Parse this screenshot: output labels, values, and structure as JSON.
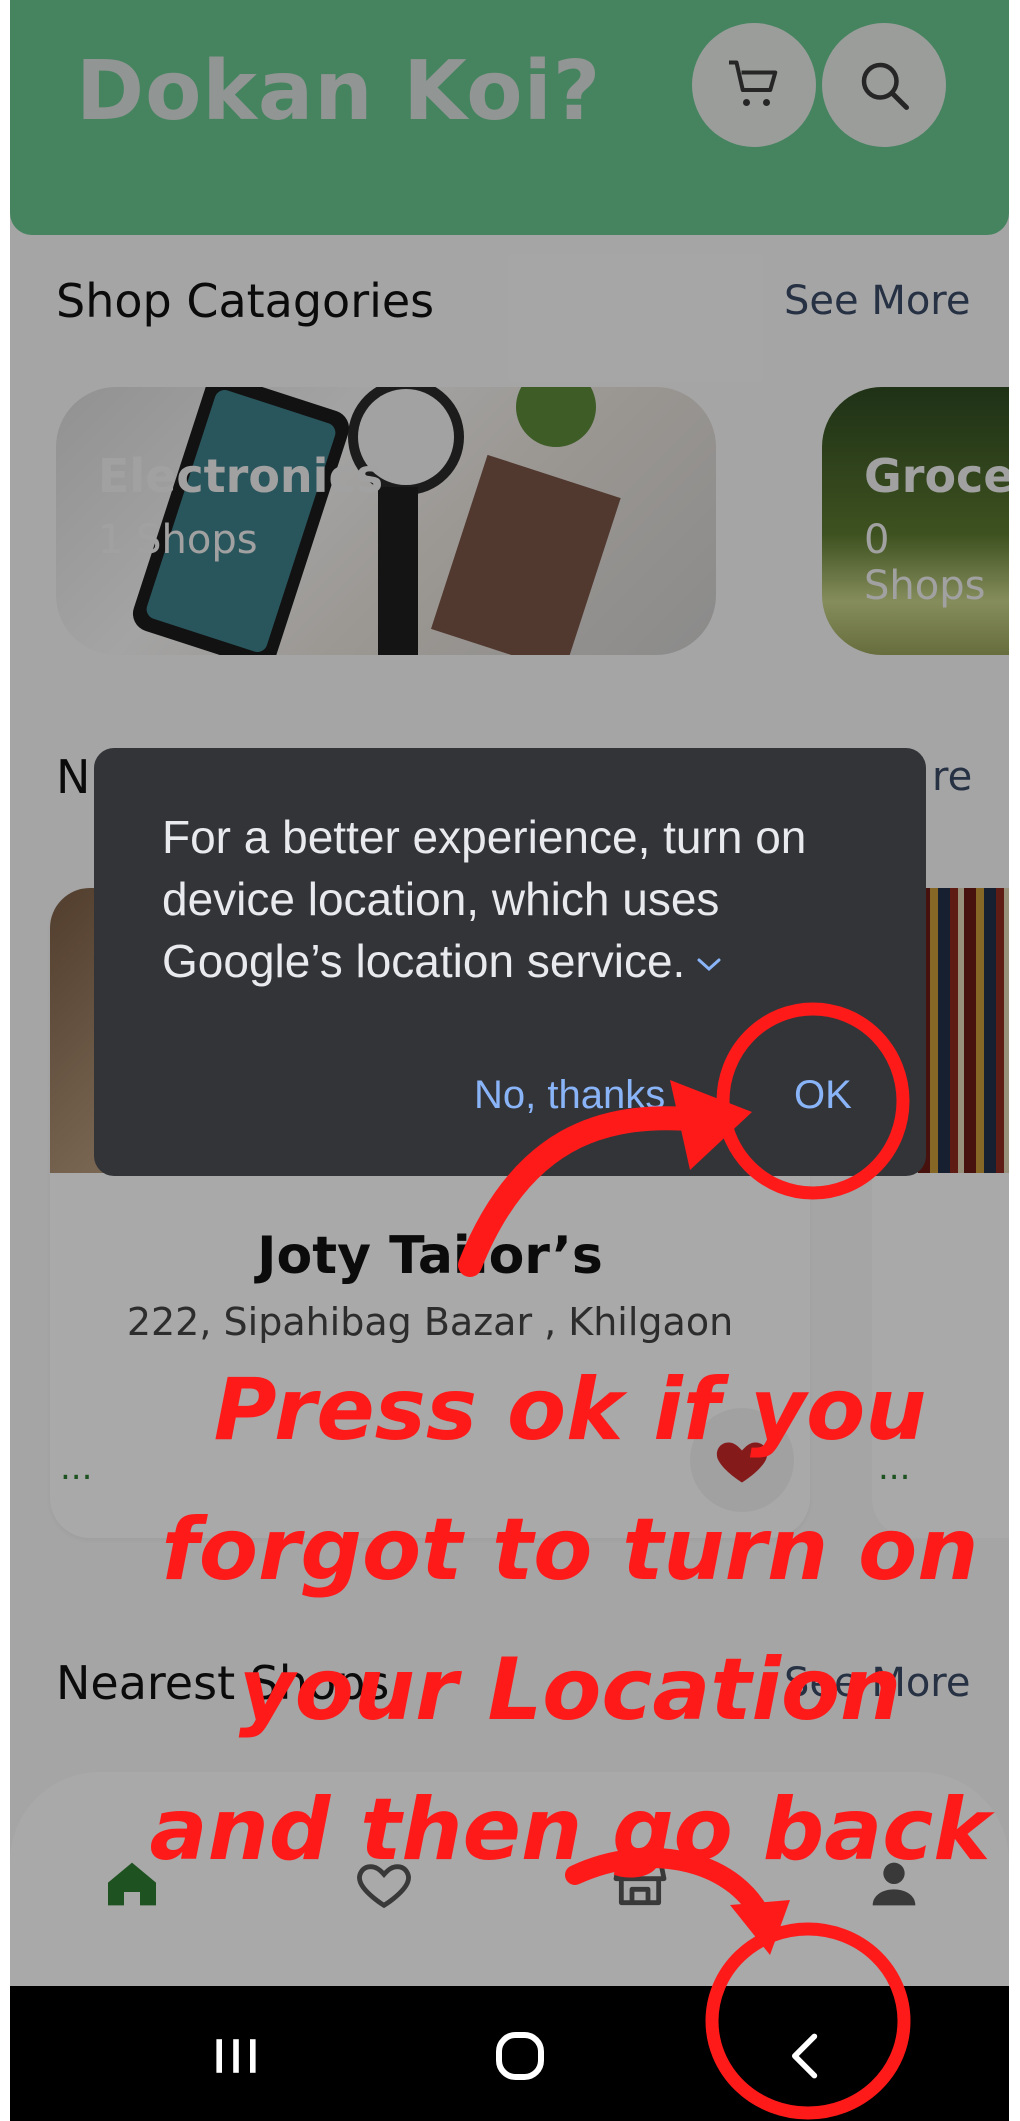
{
  "header": {
    "app_title": "Dokan Koi?",
    "cart_icon": "cart-icon",
    "search_icon": "search-icon"
  },
  "categories_section": {
    "title": "Shop Catagories",
    "see_more": "See More",
    "items": [
      {
        "name": "Electronics",
        "count": "1 Shops"
      },
      {
        "name": "Grocer",
        "count": "0 Shops"
      }
    ]
  },
  "nearby_section": {
    "title_visible": "N",
    "see_more_visible": "re"
  },
  "shop_card": {
    "name": "Joty Tailor’s",
    "address": "222, Sipahibag Bazar , Khilgaon",
    "more": "...",
    "favorite_icon": "heart-icon"
  },
  "nearest_section": {
    "title": "Nearest Shops",
    "see_more": "See More"
  },
  "bottom_nav": [
    "home-icon",
    "favorites-icon",
    "store-icon",
    "profile-icon"
  ],
  "system_nav": [
    "recents-icon",
    "home-circle-icon",
    "back-icon"
  ],
  "dialog": {
    "message": "For a better experience, turn on device location, which uses Google’s location service.",
    "no_label": "No, thanks",
    "ok_label": "OK"
  },
  "annotation": {
    "text": "Press ok if you forgot to turn on your Location and then go back",
    "color": "#ff1a1a"
  },
  "colors": {
    "header_green": "#69c590",
    "dialog_bg": "#333438",
    "dialog_button": "#8ab4f8",
    "nav_active": "#2e7d32"
  }
}
